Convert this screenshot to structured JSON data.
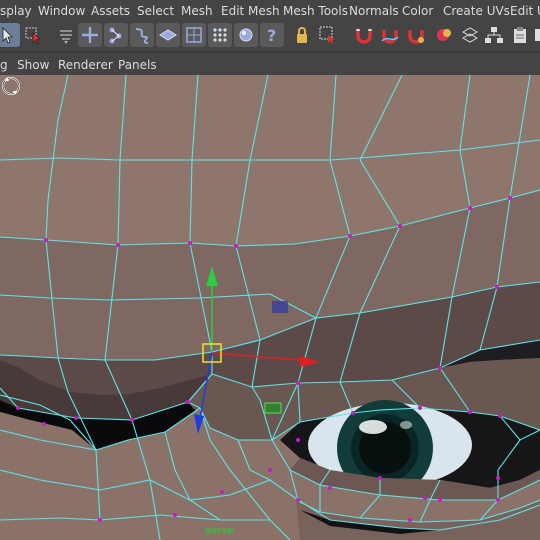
{
  "menubar": {
    "items": [
      "splay",
      "Window",
      "Assets",
      "Select",
      "Mesh",
      "Edit Mesh",
      "Mesh Tools",
      "Normals",
      "Color",
      "Create UVs",
      "Edit U"
    ]
  },
  "toolbar": {
    "buttons": [
      "select-tool-icon",
      "lasso-tool-icon",
      "paint-select-icon",
      "move-tool-icon",
      "joint-tool-icon",
      "curve-tool-icon",
      "plane-tool-icon",
      "lattice-icon",
      "vertex-points-icon",
      "snap-sphere-icon",
      "help-icon",
      "lock-icon",
      "select-box-icon",
      "magnet-icon",
      "magnet-curve-icon",
      "magnet-surface-icon",
      "ball-icon",
      "grid-snap-icon",
      "hierarchy-icon",
      "clipboard-icon",
      "toolbar-overflow-icon"
    ]
  },
  "panelbar": {
    "items": [
      "g",
      "Show",
      "Renderer",
      "Panels"
    ]
  },
  "viewport": {
    "camera_label": "persp",
    "mesh_color": "#8a7269",
    "wire_color": "#5fe3e8",
    "vertex_color": "#c21dc7"
  }
}
